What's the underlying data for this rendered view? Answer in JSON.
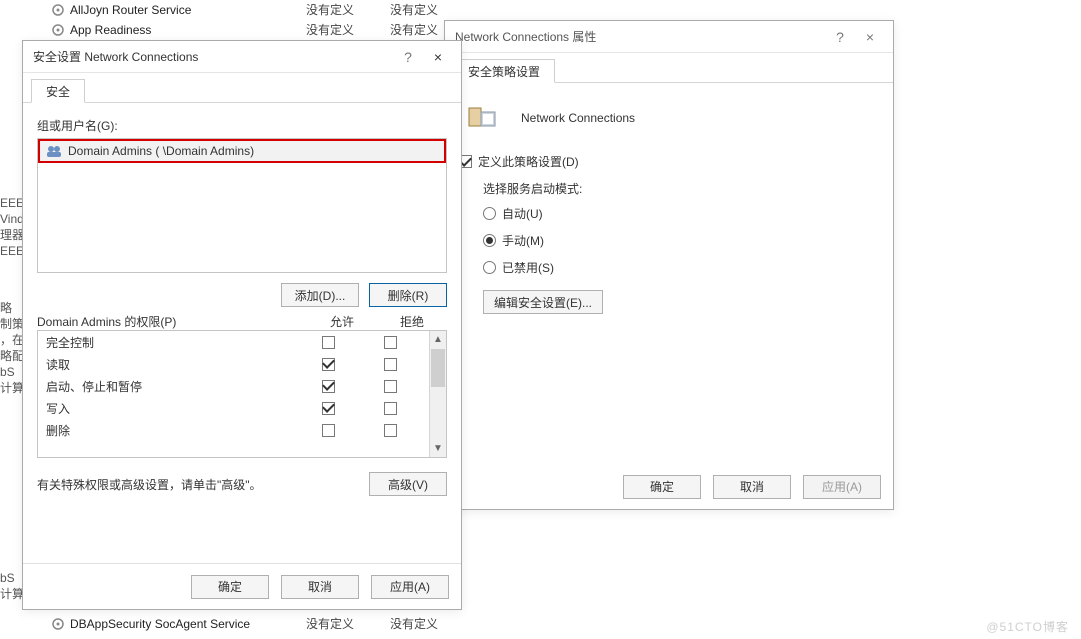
{
  "bg_services": {
    "top": [
      {
        "name": "AllJoyn Router Service",
        "c1": "没有定义",
        "c2": "没有定义"
      },
      {
        "name": "App Readiness",
        "c1": "没有定义",
        "c2": "没有定义"
      }
    ],
    "bottom": [
      {
        "name": "DBAppSecurity SocAgent Service",
        "c1": "没有定义",
        "c2": "没有定义"
      }
    ]
  },
  "stray": [
    "EEE\nVind\n理器\nEEE",
    "略\n制策\n，在\n略配\nbS\n计算机",
    "bS\n计算机"
  ],
  "watermark": "@51CTO博客",
  "sec_dialog": {
    "title": "安全设置 Network Connections",
    "help": "?",
    "close": "×",
    "tab": "安全",
    "group_label": "组或用户名(G):",
    "group_selected": "Domain Admins (          \\Domain Admins)",
    "add": "添加(D)...",
    "remove": "删除(R)",
    "perm_label": "Domain Admins 的权限(P)",
    "allow": "允许",
    "deny": "拒绝",
    "permissions": [
      {
        "label": "完全控制",
        "allow": false,
        "deny": false
      },
      {
        "label": "读取",
        "allow": true,
        "deny": false
      },
      {
        "label": "启动、停止和暂停",
        "allow": true,
        "deny": false
      },
      {
        "label": "写入",
        "allow": true,
        "deny": false
      },
      {
        "label": "删除",
        "allow": false,
        "deny": false
      }
    ],
    "hint": "有关特殊权限或高级设置，请单击\"高级\"。",
    "advanced": "高级(V)",
    "ok": "确定",
    "cancel": "取消",
    "apply": "应用(A)"
  },
  "prop_dialog": {
    "title": "Network Connections 属性",
    "help": "?",
    "close": "×",
    "tab": "安全策略设置",
    "service_name": "Network Connections",
    "define": "定义此策略设置(D)",
    "mode_label": "选择服务启动模式:",
    "mode_auto": "自动(U)",
    "mode_manual": "手动(M)",
    "mode_disabled": "已禁用(S)",
    "mode_selected": "manual",
    "edit_security": "编辑安全设置(E)...",
    "ok": "确定",
    "cancel": "取消",
    "apply": "应用(A)"
  }
}
